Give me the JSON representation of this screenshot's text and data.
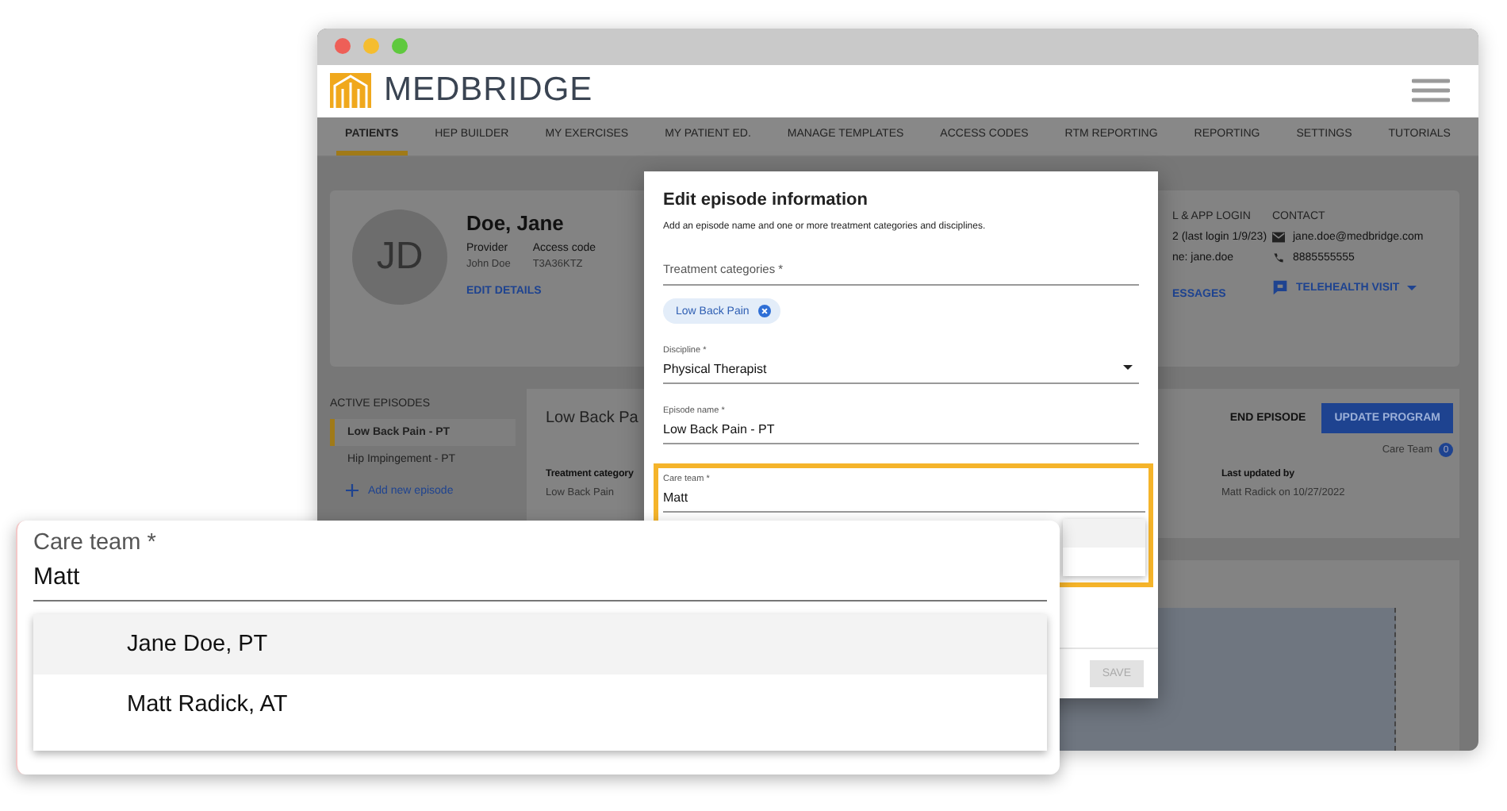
{
  "brand": {
    "name": "MEDBRIDGE"
  },
  "nav": [
    {
      "label": "PATIENTS",
      "selected": true
    },
    {
      "label": "HEP BUILDER",
      "selected": false
    },
    {
      "label": "MY EXERCISES",
      "selected": false
    },
    {
      "label": "MY PATIENT ED.",
      "selected": false
    },
    {
      "label": "MANAGE TEMPLATES",
      "selected": false
    },
    {
      "label": "ACCESS CODES",
      "selected": false
    },
    {
      "label": "RTM REPORTING",
      "selected": false
    },
    {
      "label": "REPORTING",
      "selected": false
    },
    {
      "label": "SETTINGS",
      "selected": false
    },
    {
      "label": "TUTORIALS",
      "selected": false
    }
  ],
  "patient": {
    "initials": "JD",
    "name": "Doe, Jane",
    "fields": [
      {
        "label": "Provider",
        "value": "John Doe"
      },
      {
        "label": "Access code",
        "value": "T3A36KTZ"
      }
    ],
    "edit_link": "EDIT DETAILS",
    "login": {
      "heading": "L & APP LOGIN",
      "lines": [
        "2 (last login 1/9/23)",
        "ne: jane.doe"
      ],
      "link": "ESSAGES"
    },
    "contact": {
      "heading": "CONTACT",
      "email": "jane.doe@medbridge.com",
      "phone": "8885555555",
      "telehealth": "TELEHEALTH VISIT"
    }
  },
  "episodes": {
    "heading": "ACTIVE EPISODES",
    "items": [
      {
        "label": "Low Back Pain - PT",
        "selected": true
      },
      {
        "label": "Hip Impingement - PT",
        "selected": false
      }
    ],
    "add": "Add new episode"
  },
  "episode": {
    "title": "Low Back Pa",
    "end": "END EPISODE",
    "update": "UPDATE PROGRAM",
    "care_team": "Care Team",
    "care_team_count": "0",
    "category_label": "Treatment category",
    "category_value": "Low Back Pain",
    "updated_label": "Last updated by",
    "updated_value": "Matt Radick on 10/27/2022"
  },
  "modal": {
    "title": "Edit episode information",
    "subtitle": "Add an episode name and one or more treatment categories and disciplines.",
    "categories_placeholder": "Treatment categories *",
    "chips": [
      "Low Back Pain"
    ],
    "discipline": {
      "label": "Discipline *",
      "value": "Physical Therapist"
    },
    "episode_name": {
      "label": "Episode name *",
      "value": "Low Back Pain - PT"
    },
    "care_team": {
      "label": "Care team *",
      "value": "Matt"
    },
    "save": {
      "label": "SAVE",
      "disabled": true
    }
  },
  "zoom": {
    "label": "Care team *",
    "value": "Matt",
    "options": [
      {
        "label": "Jane Doe, PT",
        "selected": true
      },
      {
        "label": "Matt Radick, AT",
        "selected": false
      }
    ]
  }
}
